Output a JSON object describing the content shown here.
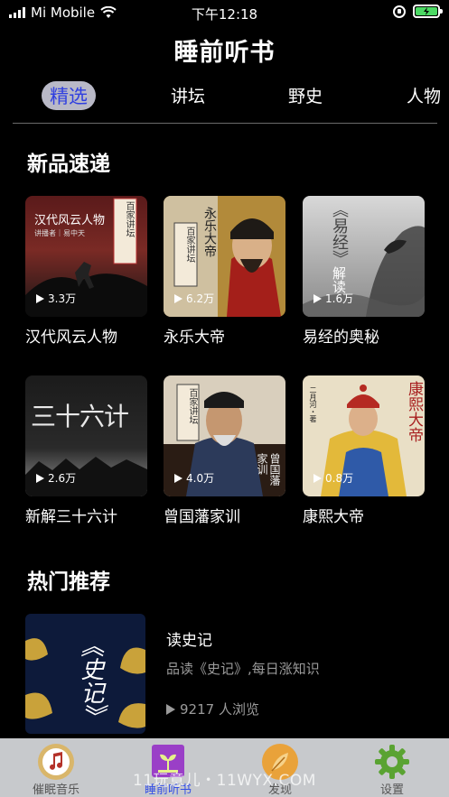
{
  "status_bar": {
    "carrier": "Mi Mobile",
    "time": "下午12:18"
  },
  "header": {
    "title": "睡前听书"
  },
  "tabs": [
    {
      "label": "精选",
      "active": true
    },
    {
      "label": "讲坛",
      "active": false
    },
    {
      "label": "野史",
      "active": false
    },
    {
      "label": "人物",
      "active": false
    }
  ],
  "sections": {
    "new_arrivals": {
      "title": "新品速递",
      "items": [
        {
          "title": "汉代风云人物",
          "plays": "3.3万",
          "cover_text": "汉代风云人物",
          "cover_sub": "讲播者｜易中天",
          "badge": "百家讲坛"
        },
        {
          "title": "永乐大帝",
          "plays": "6.2万",
          "cover_text": "永乐大帝",
          "badge": "百家讲坛"
        },
        {
          "title": "易经的奥秘",
          "plays": "1.6万",
          "cover_text": "《易经》",
          "cover_sub": "解读"
        },
        {
          "title": "新解三十六计",
          "plays": "2.6万",
          "cover_text": "三十六计"
        },
        {
          "title": "曾国藩家训",
          "plays": "4.0万",
          "cover_text": "曾国藩家训",
          "badge": "百家讲坛"
        },
        {
          "title": "康熙大帝",
          "plays": "0.8万",
          "cover_text": "康熙大帝",
          "cover_sub": "二月河・著"
        }
      ]
    },
    "hot": {
      "title": "热门推荐",
      "items": [
        {
          "title": "读史记",
          "desc": "品读《史记》,每日涨知识",
          "views": "9217 人浏览",
          "cover_text": "《史记》"
        }
      ]
    }
  },
  "tabbar": {
    "items": [
      {
        "label": "催眠音乐",
        "icon": "music-note-icon"
      },
      {
        "label": "睡前听书",
        "icon": "sprout-book-icon",
        "active": true
      },
      {
        "label": "发现",
        "icon": "feather-icon"
      },
      {
        "label": "设置",
        "icon": "gear-icon"
      }
    ]
  },
  "watermark": "11玩意儿・11WYX.COM",
  "colors": {
    "background": "#000000",
    "active_tab_bg": "#b9b9c7",
    "active_tab_text": "#2f3fe0",
    "tabbar_bg": "#c7c9cc",
    "tabbar_active": "#3550e6",
    "muted_text": "#9a9a9a"
  }
}
